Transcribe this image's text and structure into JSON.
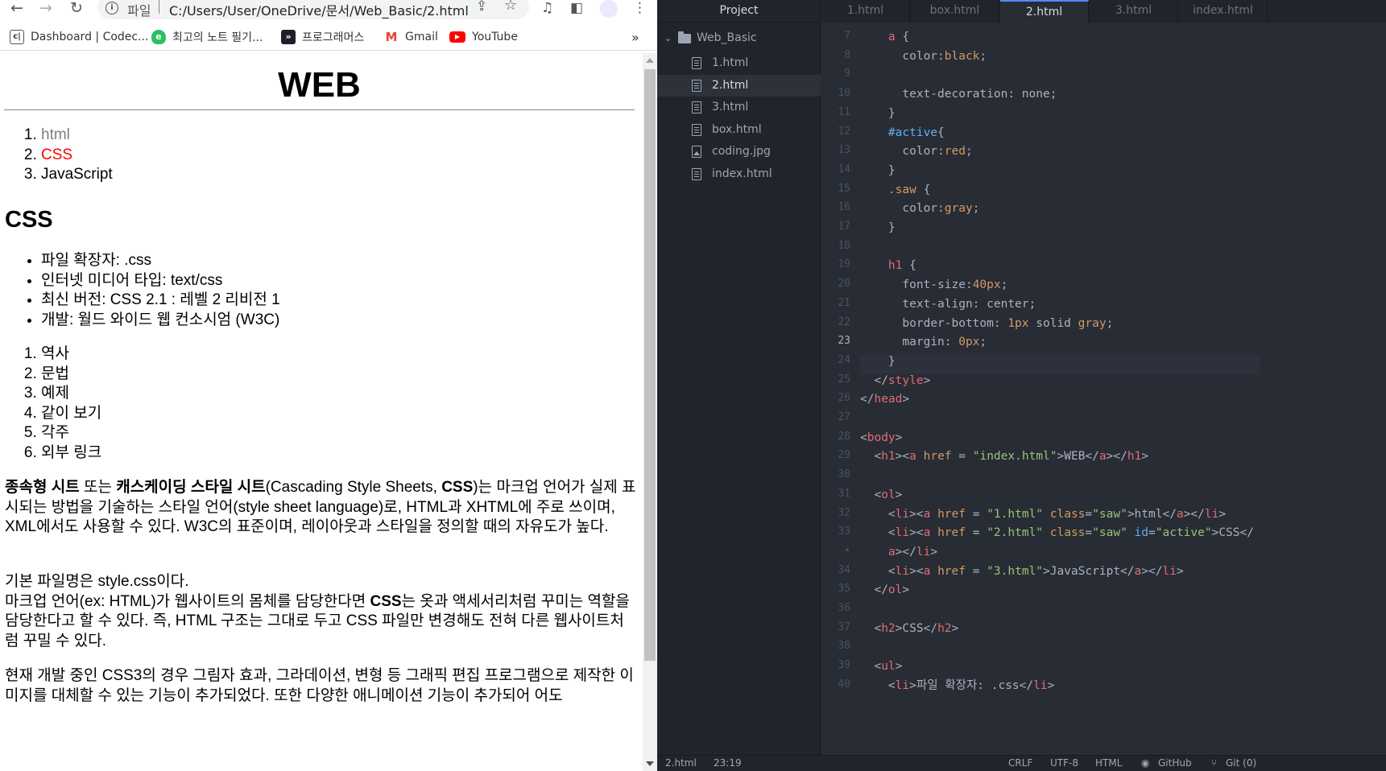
{
  "browser": {
    "omnibox": {
      "scheme_label": "파일",
      "url": "C:/Users/User/OneDrive/문서/Web_Basic/2.html"
    },
    "bookmarks": [
      {
        "label": "Dashboard | Codec...",
        "icon": "codecademy-icon"
      },
      {
        "label": "최고의 노트 필기...",
        "icon": "evernote-icon"
      },
      {
        "label": "프로그래머스",
        "icon": "programmers-icon"
      },
      {
        "label": "Gmail",
        "icon": "gmail-icon"
      },
      {
        "label": "YouTube",
        "icon": "youtube-icon"
      }
    ],
    "bookmarks_overflow": "»"
  },
  "page": {
    "h1": "WEB",
    "nav": [
      "html",
      "CSS",
      "JavaScript"
    ],
    "h2": "CSS",
    "info": [
      "파일 확장자: .css",
      "인터넷 미디어 타입: text/css",
      "최신 버전: CSS 2.1 : 레벨 2 리비전 1",
      "개발: 월드 와이드 웹 컨소시엄 (W3C)"
    ],
    "toc": [
      "역사",
      "문법",
      "예제",
      "같이 보기",
      "각주",
      "외부 링크"
    ],
    "p1_b1": "종속형 시트",
    "p1_t1": " 또는 ",
    "p1_b2": "캐스케이딩 스타일 시트",
    "p1_t2": "(Cascading Style Sheets, ",
    "p1_b3": "CSS",
    "p1_t3": ")는 마크업 언어가 실제 표시되는 방법을 기술하는 스타일 언어(style sheet language)로, HTML과 XHTML에 주로 쓰이며, XML에서도 사용할 수 있다. W3C의 표준이며, 레이아웃과 스타일을 정의할 때의 자유도가 높다.",
    "p2_line1": "기본 파일명은 style.css이다.",
    "p2_t1": "마크업 언어(ex: HTML)가 웹사이트의 몸체를 담당한다면 ",
    "p2_b1": "CSS",
    "p2_t2": "는 옷과 액세서리처럼 꾸미는 역할을 담당한다고 할 수 있다. 즉, HTML 구조는 그대로 두고 CSS 파일만 변경해도 전혀 다른 웹사이트처럼 꾸밀 수 있다.",
    "p3": "현재 개발 중인 CSS3의 경우 그림자 효과, 그라데이션, 변형 등 그래픽 편집 프로그램으로 제작한 이미지를 대체할 수 있는 기능이 추가되었다. 또한 다양한 애니메이션 기능이 추가되어 어도"
  },
  "editor": {
    "tree_header": "Project",
    "folder": "Web_Basic",
    "files": [
      "1.html",
      "2.html",
      "3.html",
      "box.html",
      "coding.jpg",
      "index.html"
    ],
    "selected_file": "2.html",
    "tabs": [
      "1.html",
      "box.html",
      "2.html",
      "3.html",
      "index.html"
    ],
    "active_tab": "2.html",
    "line_numbers": [
      "7",
      "8",
      "9",
      "10",
      "11",
      "12",
      "13",
      "14",
      "15",
      "16",
      "17",
      "18",
      "19",
      "20",
      "21",
      "22",
      "23",
      "24",
      "25",
      "26",
      "27",
      "28",
      "29",
      "30",
      "31",
      "32",
      "33",
      "•",
      "34",
      "35",
      "36",
      "37",
      "38",
      "39",
      "40"
    ],
    "current_line": "23",
    "code": [
      [
        {
          "t": "    "
        },
        {
          "c": "t-tag",
          "t": "a"
        },
        {
          "t": " {"
        }
      ],
      [
        {
          "t": "      color:"
        },
        {
          "c": "t-val",
          "t": "black"
        },
        {
          "t": ";"
        }
      ],
      [
        {
          "t": ""
        }
      ],
      [
        {
          "t": "      text-decoration: none;"
        }
      ],
      [
        {
          "t": "    }"
        }
      ],
      [
        {
          "t": "    "
        },
        {
          "c": "t-id",
          "t": "#active"
        },
        {
          "t": "{"
        }
      ],
      [
        {
          "t": "      color:"
        },
        {
          "c": "t-val",
          "t": "red"
        },
        {
          "t": ";"
        }
      ],
      [
        {
          "t": "    }"
        }
      ],
      [
        {
          "t": "    "
        },
        {
          "c": "t-cls",
          "t": ".saw"
        },
        {
          "t": " {"
        }
      ],
      [
        {
          "t": "      color:"
        },
        {
          "c": "t-val",
          "t": "gray"
        },
        {
          "t": ";"
        }
      ],
      [
        {
          "t": "    }"
        }
      ],
      [
        {
          "t": ""
        }
      ],
      [
        {
          "t": "    "
        },
        {
          "c": "t-tag",
          "t": "h1"
        },
        {
          "t": " {"
        }
      ],
      [
        {
          "t": "      font-size:"
        },
        {
          "c": "t-val",
          "t": "40px"
        },
        {
          "t": ";"
        }
      ],
      [
        {
          "t": "      text-align: center;"
        }
      ],
      [
        {
          "t": "      border-bottom: "
        },
        {
          "c": "t-val",
          "t": "1px"
        },
        {
          "t": " solid "
        },
        {
          "c": "t-val",
          "t": "gray"
        },
        {
          "t": ";"
        }
      ],
      [
        {
          "t": "      margin: "
        },
        {
          "c": "t-val",
          "t": "0px"
        },
        {
          "t": ";"
        }
      ],
      [
        {
          "t": "    }"
        }
      ],
      [
        {
          "t": "  </"
        },
        {
          "c": "t-tag",
          "t": "style"
        },
        {
          "t": ">"
        }
      ],
      [
        {
          "t": "</"
        },
        {
          "c": "t-tag",
          "t": "head"
        },
        {
          "t": ">"
        }
      ],
      [
        {
          "t": ""
        }
      ],
      [
        {
          "t": "<"
        },
        {
          "c": "t-tag",
          "t": "body"
        },
        {
          "t": ">"
        }
      ],
      [
        {
          "t": "  <"
        },
        {
          "c": "t-tag",
          "t": "h1"
        },
        {
          "t": "><"
        },
        {
          "c": "t-tag",
          "t": "a"
        },
        {
          "t": " "
        },
        {
          "c": "t-attr",
          "t": "href"
        },
        {
          "t": " = "
        },
        {
          "c": "t-str",
          "t": "\"index.html\""
        },
        {
          "t": ">WEB</"
        },
        {
          "c": "t-tag",
          "t": "a"
        },
        {
          "t": "></"
        },
        {
          "c": "t-tag",
          "t": "h1"
        },
        {
          "t": ">"
        }
      ],
      [
        {
          "t": ""
        }
      ],
      [
        {
          "t": "  <"
        },
        {
          "c": "t-tag",
          "t": "ol"
        },
        {
          "t": ">"
        }
      ],
      [
        {
          "t": "    <"
        },
        {
          "c": "t-tag",
          "t": "li"
        },
        {
          "t": "><"
        },
        {
          "c": "t-tag",
          "t": "a"
        },
        {
          "t": " "
        },
        {
          "c": "t-attr",
          "t": "href"
        },
        {
          "t": " = "
        },
        {
          "c": "t-str",
          "t": "\"1.html\""
        },
        {
          "t": " "
        },
        {
          "c": "t-attr",
          "t": "class"
        },
        {
          "t": "="
        },
        {
          "c": "t-str",
          "t": "\"saw\""
        },
        {
          "t": ">html</"
        },
        {
          "c": "t-tag",
          "t": "a"
        },
        {
          "t": "></"
        },
        {
          "c": "t-tag",
          "t": "li"
        },
        {
          "t": ">"
        }
      ],
      [
        {
          "t": "    <"
        },
        {
          "c": "t-tag",
          "t": "li"
        },
        {
          "t": "><"
        },
        {
          "c": "t-tag",
          "t": "a"
        },
        {
          "t": " "
        },
        {
          "c": "t-attr",
          "t": "href"
        },
        {
          "t": " = "
        },
        {
          "c": "t-str",
          "t": "\"2.html\""
        },
        {
          "t": " "
        },
        {
          "c": "t-attr",
          "t": "class"
        },
        {
          "t": "="
        },
        {
          "c": "t-str",
          "t": "\"saw\""
        },
        {
          "t": " "
        },
        {
          "c": "t-id",
          "t": "id"
        },
        {
          "t": "="
        },
        {
          "c": "t-str",
          "t": "\"active\""
        },
        {
          "t": ">CSS</"
        }
      ],
      [
        {
          "t": "    "
        },
        {
          "c": "t-tag",
          "t": "a"
        },
        {
          "t": "></"
        },
        {
          "c": "t-tag",
          "t": "li"
        },
        {
          "t": ">"
        }
      ],
      [
        {
          "t": "    <"
        },
        {
          "c": "t-tag",
          "t": "li"
        },
        {
          "t": "><"
        },
        {
          "c": "t-tag",
          "t": "a"
        },
        {
          "t": " "
        },
        {
          "c": "t-attr",
          "t": "href"
        },
        {
          "t": " = "
        },
        {
          "c": "t-str",
          "t": "\"3.html\""
        },
        {
          "t": ">JavaScript</"
        },
        {
          "c": "t-tag",
          "t": "a"
        },
        {
          "t": "></"
        },
        {
          "c": "t-tag",
          "t": "li"
        },
        {
          "t": ">"
        }
      ],
      [
        {
          "t": "  </"
        },
        {
          "c": "t-tag",
          "t": "ol"
        },
        {
          "t": ">"
        }
      ],
      [
        {
          "t": ""
        }
      ],
      [
        {
          "t": "  <"
        },
        {
          "c": "t-tag",
          "t": "h2"
        },
        {
          "t": ">CSS</"
        },
        {
          "c": "t-tag",
          "t": "h2"
        },
        {
          "t": ">"
        }
      ],
      [
        {
          "t": ""
        }
      ],
      [
        {
          "t": "  <"
        },
        {
          "c": "t-tag",
          "t": "ul"
        },
        {
          "t": ">"
        }
      ],
      [
        {
          "t": "    <"
        },
        {
          "c": "t-tag",
          "t": "li"
        },
        {
          "t": ">파일 확장자: .css</"
        },
        {
          "c": "t-tag",
          "t": "li"
        },
        {
          "t": ">"
        }
      ]
    ],
    "status": {
      "file": "2.html",
      "position": "23:19",
      "line_ending": "CRLF",
      "encoding": "UTF-8",
      "grammar": "HTML",
      "github": "GitHub",
      "git": "Git (0)"
    }
  },
  "colors": {
    "editor_bg": "#282c34",
    "tree_bg": "#21252b",
    "accent": "#568af2",
    "link_active": "#ff0000",
    "link_saw": "#808080"
  }
}
